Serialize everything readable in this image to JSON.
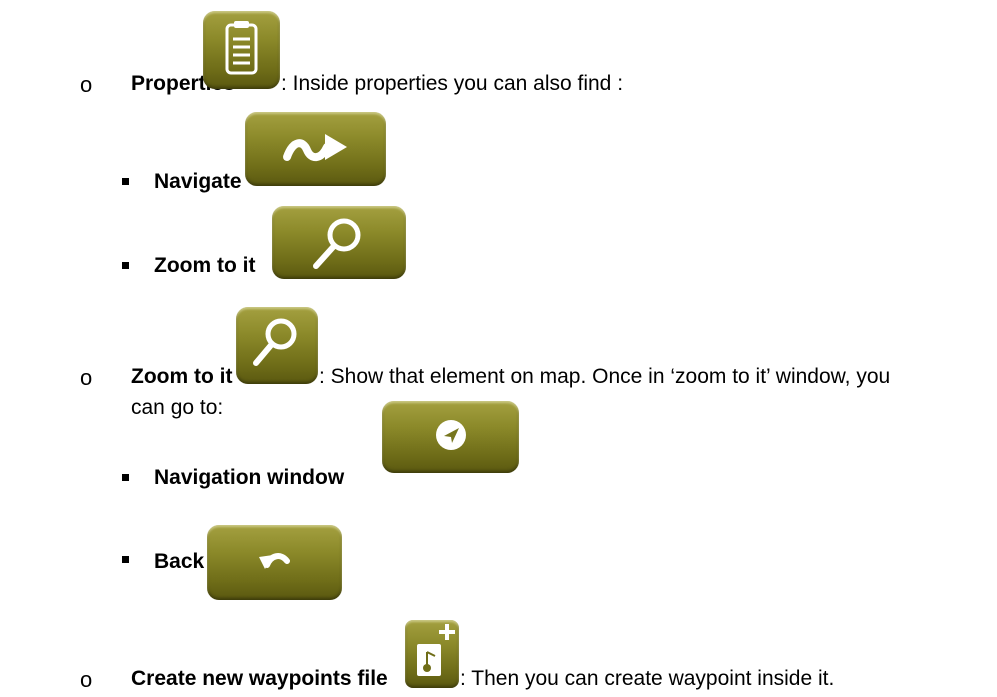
{
  "items": [
    {
      "title": "Properties",
      "description": ": Inside properties you can also find :",
      "subitems": [
        {
          "title": "Navigate"
        },
        {
          "title": "Zoom to it"
        }
      ]
    },
    {
      "title": "Zoom to it",
      "description_line1": ": Show that element on map. Once in ‘zoom to it’ window, you",
      "description_line2": "can go to:",
      "subitems": [
        {
          "title": "Navigation window"
        },
        {
          "title": "Back"
        }
      ]
    },
    {
      "title": "Create new waypoints file",
      "description": ": Then you can create waypoint inside it."
    }
  ],
  "icons": {
    "properties": "clipboard-icon",
    "navigate": "squiggle-arrow-icon",
    "zoom": "magnifier-icon",
    "navigation_window": "navigation-arrow-icon",
    "back": "undo-arrow-icon",
    "new_waypoints_file": "new-file-icon"
  },
  "colors": {
    "button_top": "#a4a040",
    "button_bottom": "#5a5810",
    "glyph": "#ffffff"
  }
}
